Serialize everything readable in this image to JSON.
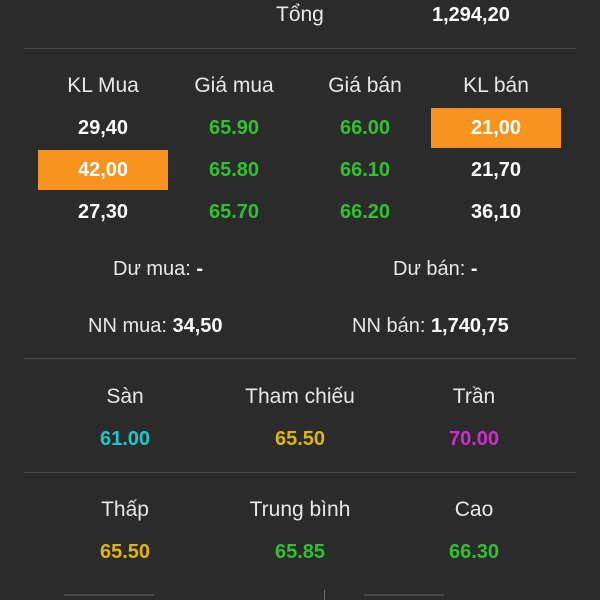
{
  "total": {
    "label": "Tổng",
    "value": "1,294,20"
  },
  "order_book": {
    "headers": [
      "KL Mua",
      "Giá mua",
      "Giá bán",
      "KL bán"
    ],
    "rows": [
      {
        "buy_volume": "29,40",
        "buy_price": "65.90",
        "sell_price": "66.00",
        "sell_volume": "21,00"
      },
      {
        "buy_volume": "42,00",
        "buy_price": "65.80",
        "sell_price": "66.10",
        "sell_volume": "21,70"
      },
      {
        "buy_volume": "27,30",
        "buy_price": "65.70",
        "sell_price": "66.20",
        "sell_volume": "36,10"
      }
    ],
    "highlight_color": "#f7931e"
  },
  "residual": {
    "buy_label": "Dư mua:",
    "buy_value": "-",
    "sell_label": "Dư bán:",
    "sell_value": "-"
  },
  "foreign": {
    "buy_label": "NN mua:",
    "buy_value": "34,50",
    "sell_label": "NN bán:",
    "sell_value": "1,740,75"
  },
  "reference": {
    "floor_label": "Sàn",
    "floor_value": "61.00",
    "ref_label": "Tham chiếu",
    "ref_value": "65.50",
    "ceiling_label": "Trần",
    "ceiling_value": "70.00"
  },
  "range": {
    "low_label": "Thấp",
    "low_value": "65.50",
    "avg_label": "Trung bình",
    "avg_value": "65.85",
    "high_label": "Cao",
    "high_value": "66.30"
  },
  "colors": {
    "background": "#2b2b2b",
    "up": "#2fc12f",
    "floor": "#1fc7c7",
    "reference": "#e0b40e",
    "ceiling": "#d22ad2"
  }
}
